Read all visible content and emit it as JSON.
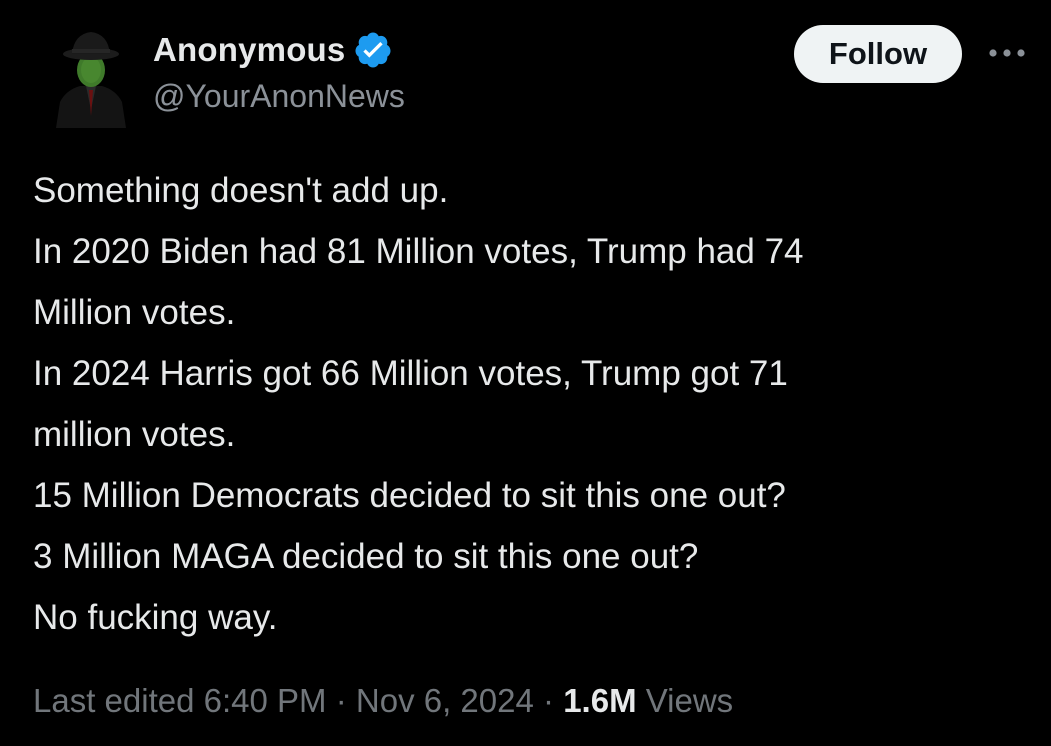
{
  "author": {
    "display_name": "Anonymous",
    "handle": "@YourAnonNews",
    "verified_icon": "verified-badge-icon",
    "avatar_icon": "anonymous-suit-avatar"
  },
  "actions": {
    "follow_label": "Follow",
    "more_icon": "more-options-icon"
  },
  "tweet": {
    "lines": [
      "Something doesn't add up.",
      "In 2020 Biden had 81 Million votes, Trump had 74",
      "Million votes.",
      "In 2024 Harris got 66 Million votes, Trump got 71",
      "million votes.",
      "15 Million Democrats decided to sit this one out?",
      "3 Million MAGA decided to sit this one out?",
      "No fucking way."
    ]
  },
  "meta": {
    "edited_label": "Last edited",
    "time": "6:40 PM",
    "separator": "·",
    "date": "Nov 6, 2024",
    "views_count": "1.6M",
    "views_label": "Views"
  },
  "colors": {
    "background": "#000000",
    "text_primary": "#e7e9ea",
    "text_secondary": "#71767b",
    "verified_blue": "#1d9bf0",
    "follow_bg": "#eff3f4"
  }
}
